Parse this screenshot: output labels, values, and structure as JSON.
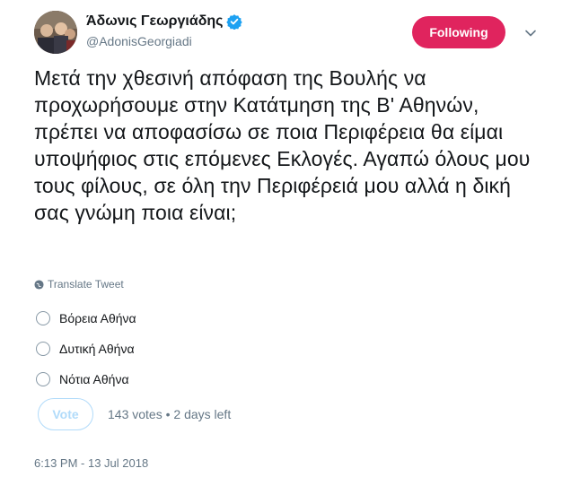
{
  "author": {
    "display_name": "Άδωνις Γεωργιάδης",
    "handle": "@AdonisGeorgiadi",
    "verified": true
  },
  "follow_button": {
    "label": "Following",
    "color": "#e0245e"
  },
  "tweet": {
    "text": "Μετά την χθεσινή απόφαση της Βουλής να προχωρήσουμε στην Κατάτμηση της Β' Αθηνών, πρέπει να αποφασίσω σε ποια Περιφέρεια θα είμαι υποψήφιος στις επόμενες Εκλογές. Αγαπώ όλους μου τους φίλους, σε όλη την Περιφέρειά μου αλλά η δική σας γνώμη ποια είναι;",
    "translate_label": "Translate Tweet"
  },
  "poll": {
    "options": [
      "Βόρεια Αθήνα",
      "Δυτική Αθήνα",
      "Νότια Αθήνα"
    ],
    "vote_label": "Vote",
    "meta": "143 votes • 2 days left"
  },
  "timestamp": "6:13 PM - 13 Jul 2018"
}
